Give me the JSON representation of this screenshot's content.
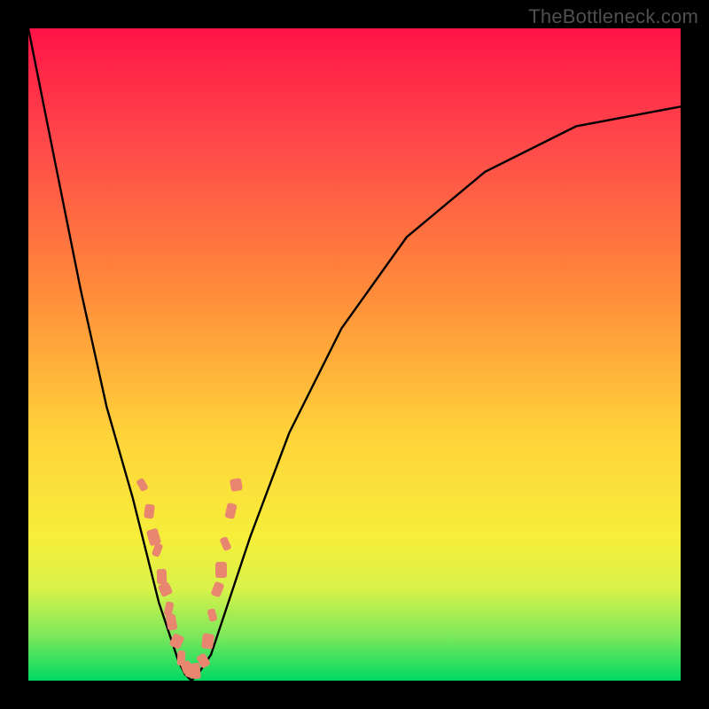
{
  "watermark": "TheBottleneck.com",
  "colors": {
    "curve_stroke": "#000000",
    "confetti": "#e9866f"
  },
  "chart_data": {
    "type": "line",
    "title": "",
    "xlabel": "",
    "ylabel": "",
    "xlim": [
      0,
      100
    ],
    "ylim": [
      0,
      100
    ],
    "x": [
      0,
      4,
      8,
      12,
      16,
      18,
      20,
      22,
      23,
      24,
      25,
      26,
      28,
      30,
      34,
      40,
      48,
      58,
      70,
      84,
      100
    ],
    "values": [
      100,
      80,
      60,
      42,
      28,
      20,
      12,
      6,
      3,
      1,
      0,
      1,
      4,
      10,
      22,
      38,
      54,
      68,
      78,
      85,
      88
    ],
    "annotations": [
      {
        "kind": "confetti",
        "x": 17.5,
        "y": 30
      },
      {
        "kind": "confetti",
        "x": 18.5,
        "y": 26
      },
      {
        "kind": "confetti",
        "x": 19.2,
        "y": 22
      },
      {
        "kind": "confetti",
        "x": 19.8,
        "y": 20
      },
      {
        "kind": "confetti",
        "x": 20.5,
        "y": 16
      },
      {
        "kind": "confetti",
        "x": 21.0,
        "y": 14
      },
      {
        "kind": "confetti",
        "x": 21.5,
        "y": 11
      },
      {
        "kind": "confetti",
        "x": 22.0,
        "y": 9
      },
      {
        "kind": "confetti",
        "x": 22.8,
        "y": 6
      },
      {
        "kind": "confetti",
        "x": 23.5,
        "y": 3.5
      },
      {
        "kind": "confetti",
        "x": 24.2,
        "y": 2
      },
      {
        "kind": "confetti",
        "x": 25.0,
        "y": 1.5
      },
      {
        "kind": "confetti",
        "x": 25.8,
        "y": 1.5
      },
      {
        "kind": "confetti",
        "x": 26.8,
        "y": 3
      },
      {
        "kind": "confetti",
        "x": 27.5,
        "y": 6
      },
      {
        "kind": "confetti",
        "x": 28.2,
        "y": 10
      },
      {
        "kind": "confetti",
        "x": 29.0,
        "y": 14
      },
      {
        "kind": "confetti",
        "x": 29.5,
        "y": 17
      },
      {
        "kind": "confetti",
        "x": 30.2,
        "y": 21
      },
      {
        "kind": "confetti",
        "x": 31.0,
        "y": 26
      },
      {
        "kind": "confetti",
        "x": 31.8,
        "y": 30
      }
    ]
  }
}
